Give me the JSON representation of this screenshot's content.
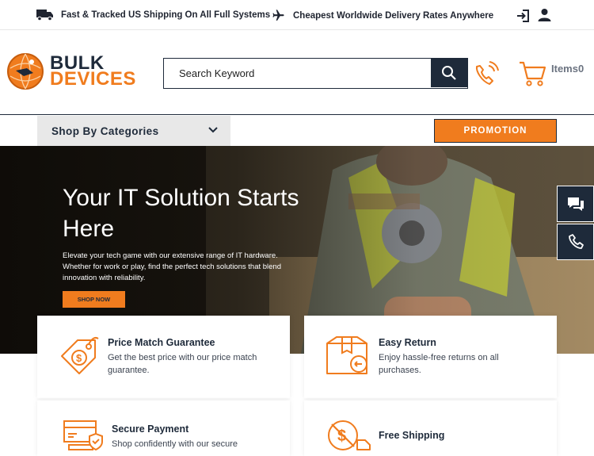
{
  "topbar": {
    "shipping_text": "Fast & Tracked US Shipping On All Full Systems",
    "delivery_text": "Cheapest Worldwide Delivery Rates Anywhere"
  },
  "header": {
    "logo_line1": "BULK",
    "logo_line2": "DEVICES",
    "search_placeholder": "Search Keyword",
    "cart_label": "Items",
    "cart_count": "0"
  },
  "nav": {
    "categories_label": "Shop By Categories",
    "promotion_label": "PROMOTION"
  },
  "hero": {
    "title": "Your IT Solution Starts Here",
    "description": "Elevate your tech game with our extensive range of IT hardware. Whether for work or play, find the perfect tech solutions that blend innovation with reliability.",
    "cta": "SHOP NOW"
  },
  "features": [
    {
      "title": "Price Match Guarantee",
      "desc": "Get the best price with our price match guarantee."
    },
    {
      "title": "Easy Return",
      "desc": "Enjoy hassle-free returns on all purchases."
    },
    {
      "title": "Secure Payment",
      "desc": "Shop confidently with our secure"
    },
    {
      "title": "Free Shipping",
      "desc": ""
    }
  ],
  "colors": {
    "accent": "#f07c1e",
    "navy": "#1e2a3a"
  }
}
